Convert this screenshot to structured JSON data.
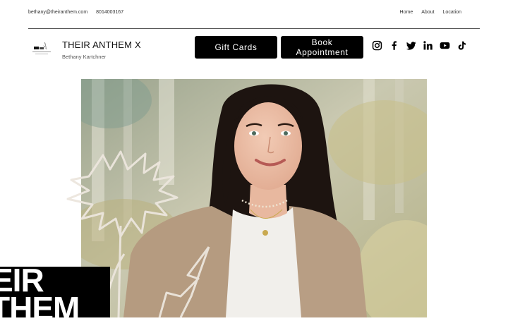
{
  "topbar": {
    "email": "bethany@theiranthem.com",
    "phone": "8014003167",
    "nav": [
      {
        "label": "Home"
      },
      {
        "label": "About"
      },
      {
        "label": "Location"
      }
    ]
  },
  "brand": {
    "title": "THEIR ANTHEM X",
    "subtitle": "Bethany Kartchner"
  },
  "buttons": {
    "gift_cards": "Gift Cards",
    "book_appointment": "Book Appointment"
  },
  "socials": [
    "instagram-icon",
    "facebook-icon",
    "twitter-icon",
    "linkedin-icon",
    "youtube-icon",
    "tiktok-icon"
  ],
  "hero_overlay": {
    "line1": "EIR",
    "line2": "THEM"
  },
  "colors": {
    "button_bg": "#000000",
    "button_text": "#ffffff",
    "divider": "#555555"
  }
}
